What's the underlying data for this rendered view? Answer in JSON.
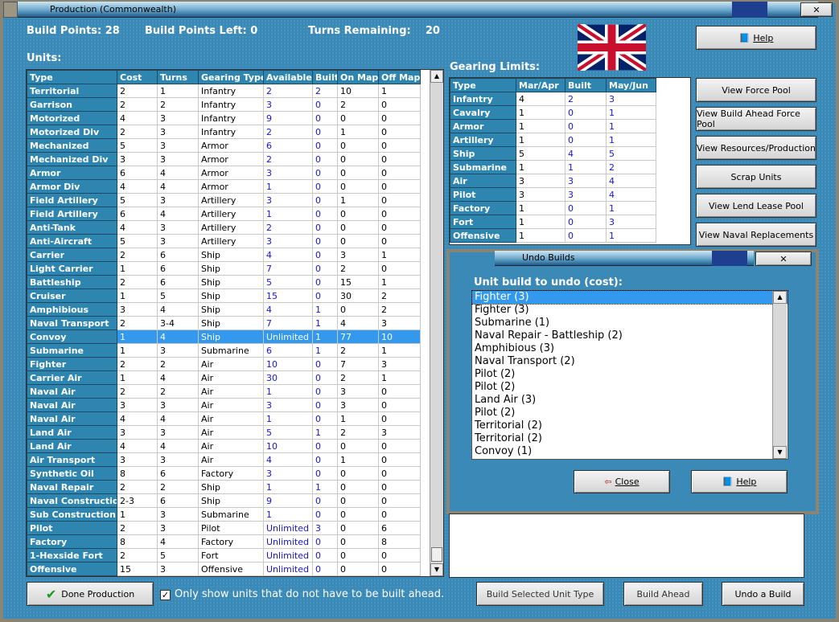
{
  "window": {
    "title": "Production (Commonwealth)"
  },
  "stats": {
    "build_points_label": "Build Points:",
    "build_points": "28",
    "left_label": "Build Points Left:",
    "left": "0",
    "turns_label": "Turns Remaining:",
    "turns": "20"
  },
  "units": {
    "label": "Units:",
    "columns": [
      "Type",
      "Cost",
      "Turns",
      "Gearing Type",
      "Available",
      "Built",
      "On Map",
      "Off Map"
    ],
    "rows": [
      [
        "Territorial",
        "2",
        "1",
        "Infantry",
        "2",
        "2",
        "10",
        "1"
      ],
      [
        "Garrison",
        "2",
        "2",
        "Infantry",
        "3",
        "0",
        "2",
        "0"
      ],
      [
        "Motorized",
        "4",
        "3",
        "Infantry",
        "9",
        "0",
        "0",
        "0"
      ],
      [
        "Motorized Div",
        "2",
        "3",
        "Infantry",
        "2",
        "0",
        "1",
        "0"
      ],
      [
        "Mechanized",
        "5",
        "3",
        "Armor",
        "6",
        "0",
        "0",
        "0"
      ],
      [
        "Mechanized Div",
        "3",
        "3",
        "Armor",
        "2",
        "0",
        "0",
        "0"
      ],
      [
        "Armor",
        "6",
        "4",
        "Armor",
        "3",
        "0",
        "0",
        "0"
      ],
      [
        "Armor Div",
        "4",
        "4",
        "Armor",
        "1",
        "0",
        "0",
        "0"
      ],
      [
        "Field Artillery",
        "5",
        "3",
        "Artillery",
        "3",
        "0",
        "1",
        "0"
      ],
      [
        "Field Artillery",
        "6",
        "4",
        "Artillery",
        "1",
        "0",
        "0",
        "0"
      ],
      [
        "Anti-Tank",
        "4",
        "3",
        "Artillery",
        "2",
        "0",
        "0",
        "0"
      ],
      [
        "Anti-Aircraft",
        "5",
        "3",
        "Artillery",
        "3",
        "0",
        "0",
        "0"
      ],
      [
        "Carrier",
        "2",
        "6",
        "Ship",
        "4",
        "0",
        "3",
        "1"
      ],
      [
        "Light Carrier",
        "1",
        "6",
        "Ship",
        "7",
        "0",
        "2",
        "0"
      ],
      [
        "Battleship",
        "2",
        "6",
        "Ship",
        "5",
        "0",
        "15",
        "1"
      ],
      [
        "Cruiser",
        "1",
        "5",
        "Ship",
        "15",
        "0",
        "30",
        "2"
      ],
      [
        "Amphibious",
        "3",
        "4",
        "Ship",
        "4",
        "1",
        "0",
        "2"
      ],
      [
        "Naval Transport",
        "2",
        "3-4",
        "Ship",
        "7",
        "1",
        "4",
        "3"
      ],
      [
        "Convoy",
        "1",
        "4",
        "Ship",
        "Unlimited",
        "1",
        "77",
        "10"
      ],
      [
        "Submarine",
        "1",
        "3",
        "Submarine",
        "6",
        "1",
        "2",
        "1"
      ],
      [
        "Fighter",
        "2",
        "2",
        "Air",
        "10",
        "0",
        "7",
        "3"
      ],
      [
        "Carrier Air",
        "1",
        "4",
        "Air",
        "30",
        "0",
        "2",
        "1"
      ],
      [
        "Naval Air",
        "2",
        "2",
        "Air",
        "1",
        "0",
        "3",
        "0"
      ],
      [
        "Naval Air",
        "3",
        "3",
        "Air",
        "3",
        "0",
        "3",
        "0"
      ],
      [
        "Naval Air",
        "4",
        "4",
        "Air",
        "1",
        "0",
        "1",
        "0"
      ],
      [
        "Land Air",
        "3",
        "3",
        "Air",
        "5",
        "1",
        "2",
        "3"
      ],
      [
        "Land Air",
        "4",
        "4",
        "Air",
        "10",
        "0",
        "0",
        "0"
      ],
      [
        "Air Transport",
        "3",
        "3",
        "Air",
        "4",
        "0",
        "1",
        "0"
      ],
      [
        "Synthetic Oil",
        "8",
        "6",
        "Factory",
        "3",
        "0",
        "0",
        "0"
      ],
      [
        "Naval Repair",
        "2",
        "2",
        "Ship",
        "1",
        "1",
        "0",
        "0"
      ],
      [
        "Naval Construction",
        "2-3",
        "6",
        "Ship",
        "9",
        "0",
        "0",
        "0"
      ],
      [
        "Sub Construction",
        "1",
        "3",
        "Submarine",
        "1",
        "0",
        "0",
        "0"
      ],
      [
        "Pilot",
        "2",
        "3",
        "Pilot",
        "Unlimited",
        "3",
        "0",
        "6"
      ],
      [
        "Factory",
        "8",
        "4",
        "Factory",
        "Unlimited",
        "0",
        "0",
        "8"
      ],
      [
        "1-Hexside Fort",
        "2",
        "5",
        "Fort",
        "Unlimited",
        "0",
        "0",
        "0"
      ],
      [
        "Offensive",
        "15",
        "3",
        "Offensive",
        "Unlimited",
        "0",
        "0",
        "0"
      ]
    ],
    "selected_index": 18
  },
  "gearing": {
    "label": "Gearing Limits:",
    "columns": [
      "Type",
      "Mar/Apr",
      "Built",
      "May/Jun"
    ],
    "rows": [
      [
        "Infantry",
        "4",
        "2",
        "3"
      ],
      [
        "Cavalry",
        "1",
        "0",
        "1"
      ],
      [
        "Armor",
        "1",
        "0",
        "1"
      ],
      [
        "Artillery",
        "1",
        "0",
        "1"
      ],
      [
        "Ship",
        "5",
        "4",
        "5"
      ],
      [
        "Submarine",
        "1",
        "1",
        "2"
      ],
      [
        "Air",
        "3",
        "3",
        "4"
      ],
      [
        "Pilot",
        "3",
        "3",
        "4"
      ],
      [
        "Factory",
        "1",
        "0",
        "1"
      ],
      [
        "Fort",
        "1",
        "0",
        "3"
      ],
      [
        "Offensive",
        "1",
        "0",
        "1"
      ]
    ]
  },
  "right_buttons": {
    "help": "Help",
    "force_pool": "View Force Pool",
    "build_ahead_pool": "View Build Ahead Force Pool",
    "resources": "View Resources/Production",
    "scrap": "Scrap Units",
    "lend_lease": "View Lend Lease Pool",
    "naval_repl": "View Naval Replacements"
  },
  "undo": {
    "title": "Undo Builds",
    "label": "Unit build to undo (cost):",
    "items": [
      "Fighter (3)",
      "Fighter (3)",
      "Submarine (1)",
      "Naval Repair - Battleship (2)",
      "Amphibious (3)",
      "Naval Transport (2)",
      "Pilot (2)",
      "Pilot (2)",
      "Land Air (3)",
      "Pilot (2)",
      "Territorial (2)",
      "Territorial (2)",
      "Convoy (1)"
    ],
    "close": "Close",
    "help": "Help"
  },
  "bottom": {
    "done": "Done Production",
    "checkbox_label": "Only show units that do not have to be built ahead.",
    "checkbox_checked": true,
    "build_selected": "Build Selected Unit Type",
    "build_ahead": "Build Ahead",
    "undo_build": "Undo a Build"
  }
}
